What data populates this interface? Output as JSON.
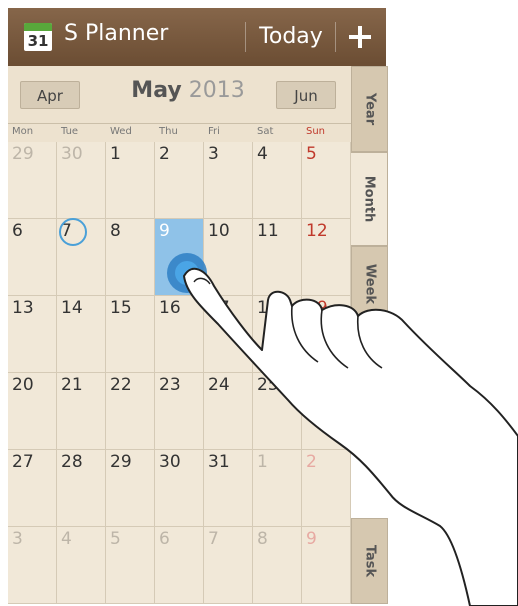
{
  "header": {
    "app_icon_day": "31",
    "title": "S Planner",
    "today_label": "Today",
    "add_label": "+"
  },
  "month_bar": {
    "prev_label": "Apr",
    "month": "May",
    "year": "2013",
    "next_label": "Jun"
  },
  "weekdays": [
    "Mon",
    "Tue",
    "Wed",
    "Thu",
    "Fri",
    "Sat",
    "Sun"
  ],
  "weeks": [
    [
      "29",
      "30",
      "1",
      "2",
      "3",
      "4",
      "5"
    ],
    [
      "6",
      "7",
      "8",
      "9",
      "10",
      "11",
      "12"
    ],
    [
      "13",
      "14",
      "15",
      "16",
      "17",
      "18",
      "19"
    ],
    [
      "20",
      "21",
      "22",
      "23",
      "24",
      "25",
      "26"
    ],
    [
      "27",
      "28",
      "29",
      "30",
      "31",
      "1",
      "2"
    ],
    [
      "3",
      "4",
      "5",
      "6",
      "7",
      "8",
      "9"
    ]
  ],
  "selected_day": "9",
  "today_day": "7",
  "side_tabs": {
    "year": "Year",
    "month": "Month",
    "week": "Week",
    "task": "Task"
  },
  "colors": {
    "header": "#7a5a3d",
    "paper": "#f1e8d8",
    "sunday": "#c0392b",
    "selected": "#8fc2e8",
    "today_ring": "#4aa0d8"
  }
}
